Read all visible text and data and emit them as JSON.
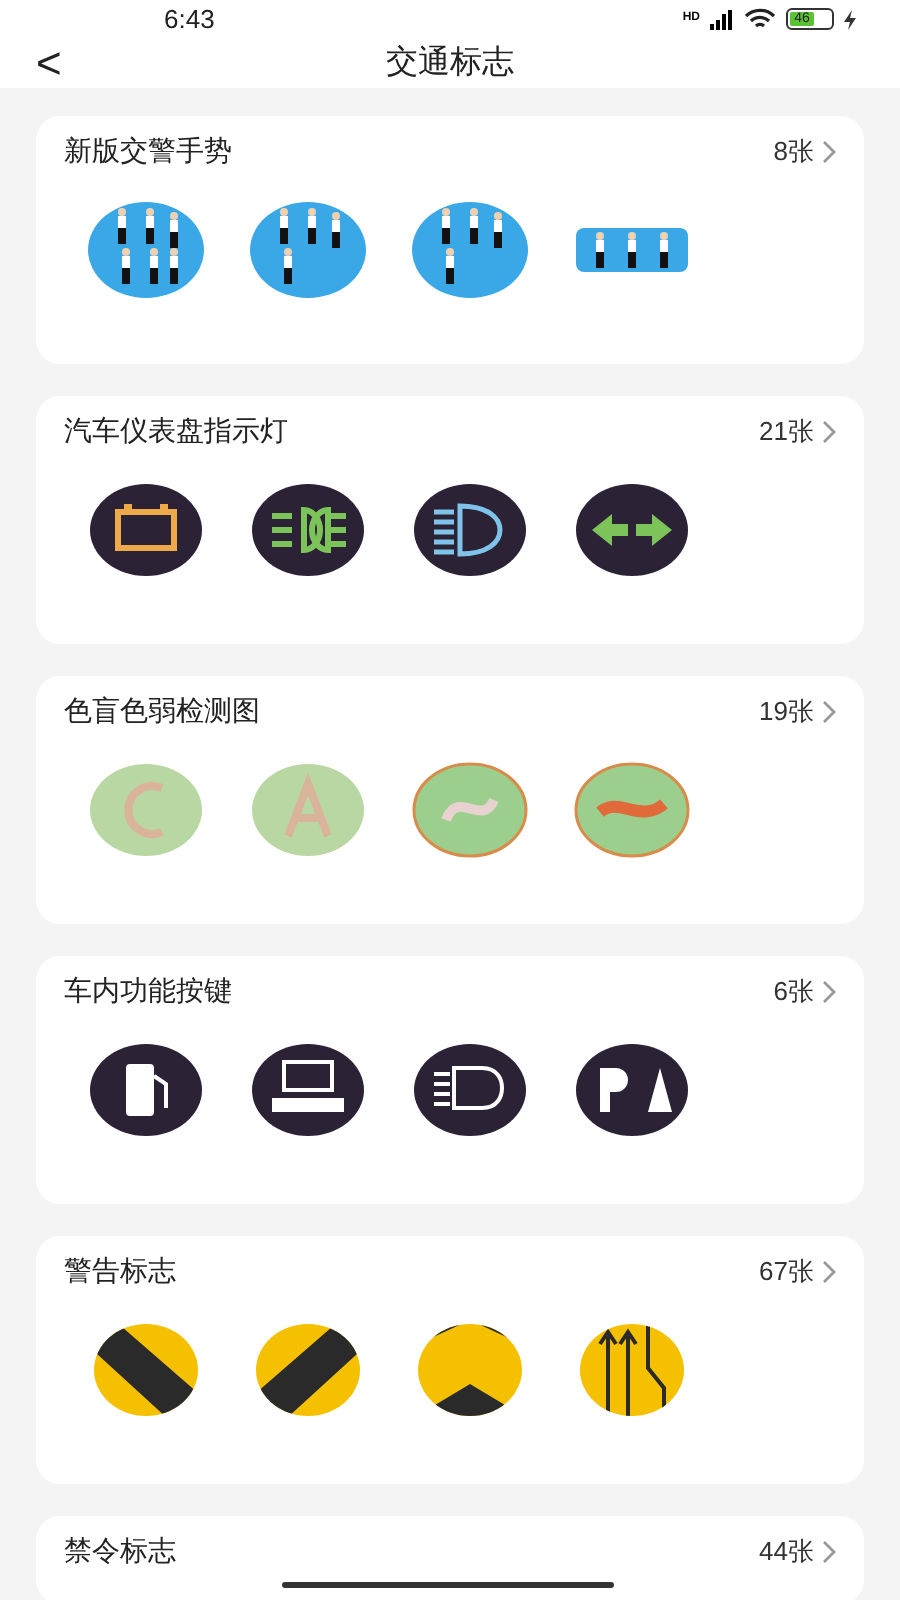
{
  "status_bar": {
    "time": "6:43",
    "network": "HD",
    "battery": "46"
  },
  "header": {
    "back": "<",
    "title": "交通标志"
  },
  "categories": [
    {
      "title": "新版交警手势",
      "count": "8张",
      "kind": "gesture"
    },
    {
      "title": "汽车仪表盘指示灯",
      "count": "21张",
      "kind": "dashboard"
    },
    {
      "title": "色盲色弱检测图",
      "count": "19张",
      "kind": "colorblind"
    },
    {
      "title": "车内功能按键",
      "count": "6张",
      "kind": "buttons"
    },
    {
      "title": "警告标志",
      "count": "67张",
      "kind": "warning"
    },
    {
      "title": "禁令标志",
      "count": "44张",
      "kind": "none"
    }
  ]
}
